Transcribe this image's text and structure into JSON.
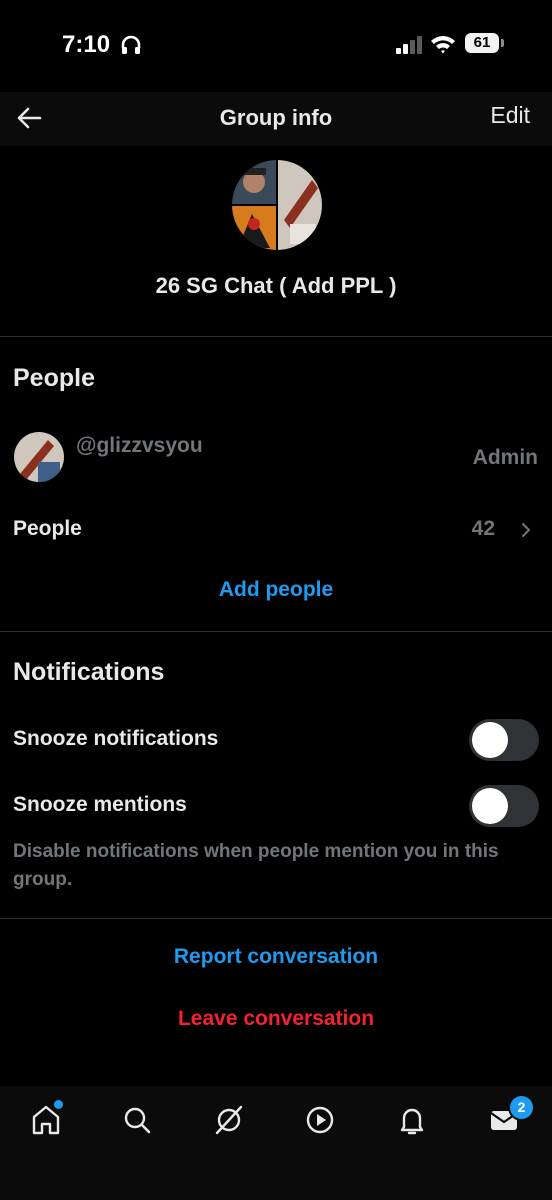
{
  "status_bar": {
    "time": "7:10",
    "battery": "61"
  },
  "header": {
    "title": "Group info",
    "edit_label": "Edit"
  },
  "group": {
    "name": "26 SG Chat ( Add PPL )"
  },
  "people_section": {
    "title": "People",
    "members": [
      {
        "handle": "@glizzvsyou",
        "role": "Admin"
      }
    ],
    "people_row": {
      "label": "People",
      "count": "42"
    },
    "add_people_label": "Add people"
  },
  "notifications_section": {
    "title": "Notifications",
    "snooze_notifications": {
      "label": "Snooze notifications",
      "enabled": false
    },
    "snooze_mentions": {
      "label": "Snooze mentions",
      "enabled": false
    },
    "hint": "Disable notifications when people mention you in this group."
  },
  "actions": {
    "report_label": "Report conversation",
    "leave_label": "Leave conversation"
  },
  "tab_bar": {
    "tabs": [
      "home-icon",
      "search-icon",
      "grok-icon",
      "video-icon",
      "notifications-icon",
      "messages-icon"
    ],
    "messages_badge": "2"
  },
  "colors": {
    "accent": "#1d9bf0",
    "danger": "#f4212e",
    "muted": "#71767b",
    "background": "#000000"
  }
}
